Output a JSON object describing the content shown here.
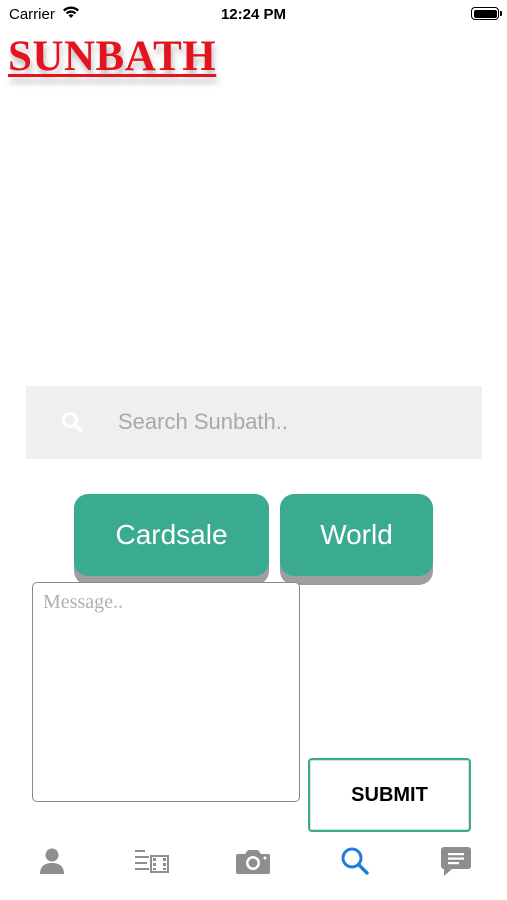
{
  "status_bar": {
    "carrier": "Carrier",
    "time": "12:24 PM"
  },
  "header": {
    "logo_text": "SUNBATH"
  },
  "search": {
    "placeholder": "Search Sunbath.."
  },
  "categories": [
    {
      "label": "Cardsale"
    },
    {
      "label": "World"
    }
  ],
  "message": {
    "placeholder": "Message..",
    "submit_label": "SUBMIT"
  },
  "tab_bar": {
    "items": [
      {
        "icon": "profile-icon",
        "active": false
      },
      {
        "icon": "feed-icon",
        "active": false
      },
      {
        "icon": "camera-icon",
        "active": false
      },
      {
        "icon": "search-icon",
        "active": true
      },
      {
        "icon": "messages-icon",
        "active": false
      }
    ]
  },
  "colors": {
    "brand_red": "#e3141f",
    "accent_teal": "#3aaa91",
    "active_tab_blue": "#1e7fd8",
    "inactive_tab_gray": "#8e8e8e"
  }
}
